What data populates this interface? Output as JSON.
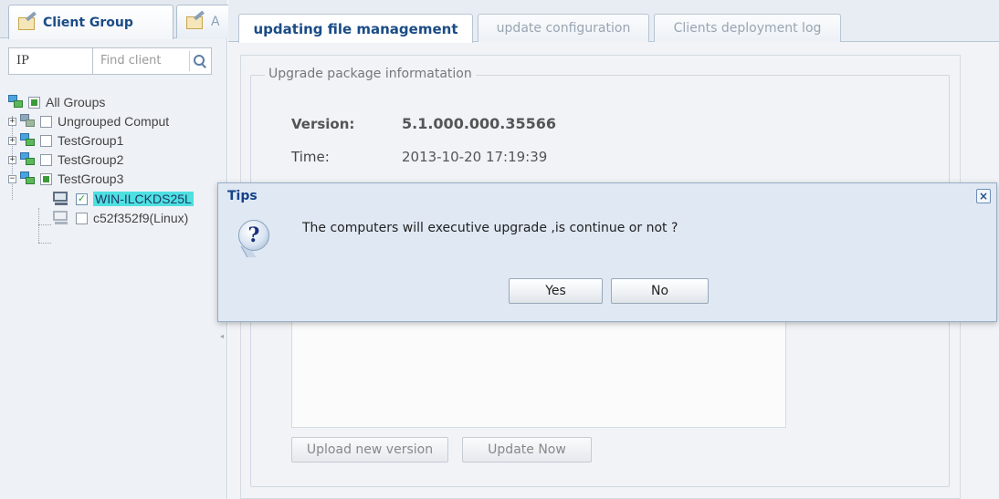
{
  "left_tabs": [
    {
      "label": "Client Group",
      "active": true
    },
    {
      "label": "A",
      "active": false
    }
  ],
  "search": {
    "field": "IP",
    "placeholder": "Find client"
  },
  "tree": {
    "root": "All Groups",
    "groups": [
      {
        "label": "Ungrouped Comput",
        "icon": "group-grey-icon"
      },
      {
        "label": "TestGroup1",
        "icon": "group-icon"
      },
      {
        "label": "TestGroup2",
        "icon": "group-icon"
      },
      {
        "label": "TestGroup3",
        "icon": "group-icon",
        "expanded": true
      }
    ],
    "clients": [
      {
        "label": "WIN-ILCKDS25L",
        "checked": true,
        "selected": true
      },
      {
        "label": "c52f352f9(Linux)",
        "checked": false,
        "selected": false
      }
    ]
  },
  "main_tabs": [
    {
      "label": "updating file management",
      "active": true
    },
    {
      "label": "update configuration",
      "active": false
    },
    {
      "label": "Clients deployment log",
      "active": false
    }
  ],
  "package_info": {
    "legend": "Upgrade package informatation",
    "version_label": "Version:",
    "version_value": "5.1.000.000.35566",
    "time_label": "Time:",
    "time_value": "2013-10-20 17:19:39"
  },
  "buttons": {
    "upload": "Upload new version",
    "update": "Update Now"
  },
  "dialog": {
    "title": "Tips",
    "message": "The computers will executive upgrade ,is continue or not ?",
    "yes": "Yes",
    "no": "No",
    "close": "×"
  },
  "colors": {
    "selection": "#4fe0e0",
    "tab_text": "#1a4c86",
    "dialog_title": "#15428b"
  }
}
